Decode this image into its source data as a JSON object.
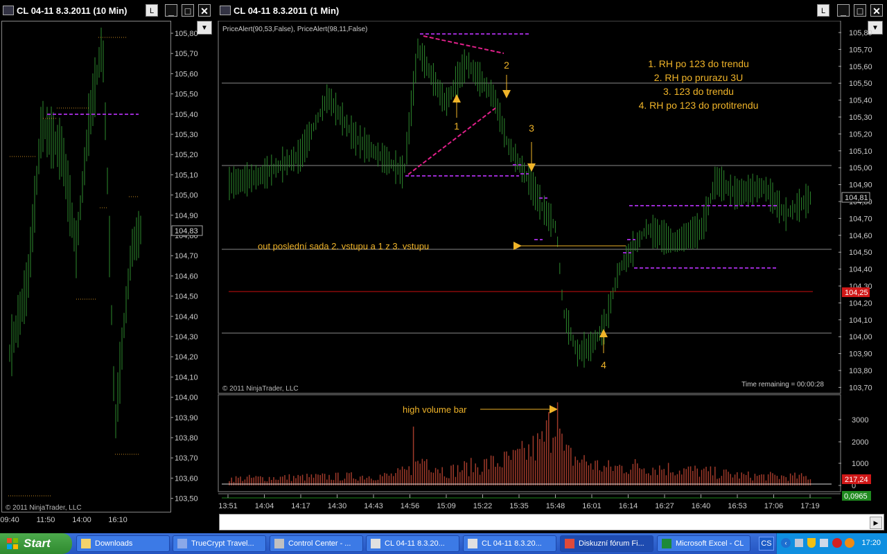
{
  "left_window": {
    "title": "CL 04-11  8.3.2011 (10 Min)",
    "btn_l": "L",
    "btn_min": "_",
    "btn_max": "□",
    "btn_close": "✕",
    "copyright": "© 2011 NinjaTrader, LLC",
    "price_ticks": [
      "105,80",
      "105,70",
      "105,60",
      "105,50",
      "105,40",
      "105,30",
      "105,20",
      "105,10",
      "105,00",
      "104,90",
      "104,80",
      "104,70",
      "104,60",
      "104,50",
      "104,40",
      "104,30",
      "104,20",
      "104,10",
      "104,00",
      "103,90",
      "103,80",
      "103,70",
      "103,60",
      "103,50"
    ],
    "current_price": "104,83",
    "time_ticks": [
      "09:40",
      "11:50",
      "14:00",
      "16:10"
    ]
  },
  "main_window": {
    "title": "CL 04-11  8.3.2011 (1 Min)",
    "btn_l": "L",
    "btn_min": "_",
    "btn_max": "□",
    "btn_close": "✕",
    "indicator_label": "PriceAlert(90,53,False), PriceAlert(98,11,False)",
    "copyright": "© 2011 NinjaTrader, LLC",
    "time_remaining": "Time remaining = 00:00:28",
    "price_ticks": [
      "105,80",
      "105,70",
      "105,60",
      "105,50",
      "105,40",
      "105,30",
      "105,20",
      "105,10",
      "105,00",
      "104,90",
      "104,80",
      "104,70",
      "104,60",
      "104,50",
      "104,40",
      "104,30",
      "104,20",
      "104,10",
      "104,00",
      "103,90",
      "103,80",
      "103,70"
    ],
    "current_price": "104,81",
    "alert_price": "104,25",
    "volume_ticks": [
      "3000",
      "2000",
      "1000",
      "0"
    ],
    "volume_value": "217,24",
    "indicator_value": "0,0965",
    "time_ticks": [
      "13:51",
      "14:04",
      "14:17",
      "14:30",
      "14:43",
      "14:56",
      "15:09",
      "15:22",
      "15:35",
      "15:48",
      "16:01",
      "16:14",
      "16:27",
      "16:40",
      "16:53",
      "17:06",
      "17:19"
    ],
    "legend_lines": [
      "1. RH po 123 do trendu",
      "2. RH po prurazu 3U",
      "3. 123 do trendu",
      "4. RH po 123 do protitrendu"
    ],
    "note_out": "out poslední sada 2. vstupu a 1 z 3. vstupu",
    "note_volume": "high  volume bar",
    "markers": [
      "1",
      "2",
      "3",
      "4"
    ],
    "colors": {
      "candle": "#2e8b2e",
      "annotation": "#f0b429",
      "level_line": "#8a8a8a",
      "alert_line": "#cc1111",
      "dash_purple": "#9a2ad0",
      "dash_pink": "#e0208a",
      "volume": "#a03a2a"
    }
  },
  "taskbar": {
    "start_label": "Start",
    "items": [
      {
        "label": "Downloads",
        "icon": "folder-icon"
      },
      {
        "label": "TrueCrypt Travel...",
        "icon": "truecrypt-icon"
      },
      {
        "label": "Control Center - ...",
        "icon": "control-center-icon"
      },
      {
        "label": "CL 04-11  8.3.20...",
        "icon": "ninjatrader-icon"
      },
      {
        "label": "CL 04-11  8.3.20...",
        "icon": "ninjatrader-icon"
      },
      {
        "label": "Diskuzní fórum Fi...",
        "icon": "chrome-icon"
      },
      {
        "label": "Microsoft Excel - CL",
        "icon": "excel-icon"
      }
    ],
    "lang": "CS",
    "clock": "17:20"
  }
}
